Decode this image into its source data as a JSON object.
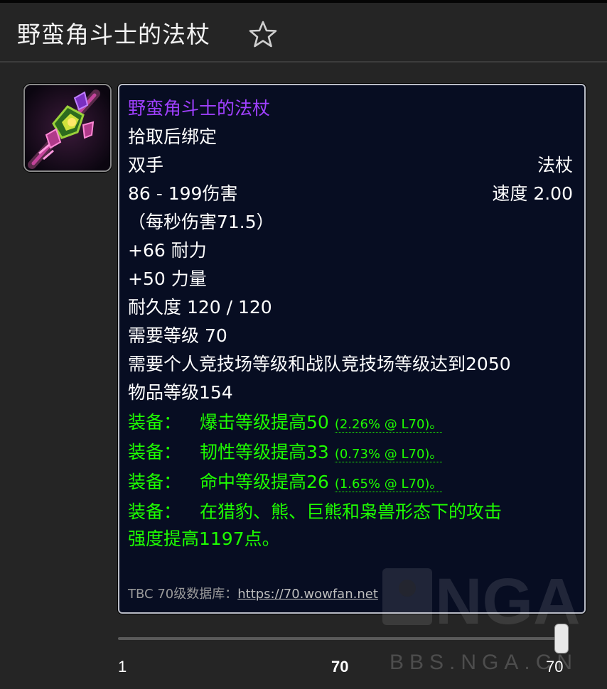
{
  "header": {
    "title": "野蛮角斗士的法杖"
  },
  "item": {
    "name": "野蛮角斗士的法杖",
    "binding": "拾取后绑定",
    "slot": "双手",
    "type": "法杖",
    "damage": "86 - 199伤害",
    "speed": "速度 2.00",
    "dps": "（每秒伤害71.5）",
    "stat1": "+66 耐力",
    "stat2": "+50 力量",
    "durability": "耐久度 120 / 120",
    "required_level": "需要等级 70",
    "arena_requirement": "需要个人竞技场等级和战队竞技场等级达到2050",
    "item_level": "物品等级154",
    "equip_label": "装备：",
    "equip1": "爆击等级提高50",
    "equip1_note": "(2.26% @ L70)。",
    "equip2": "韧性等级提高33",
    "equip2_note": "(0.73% @ L70)。",
    "equip3": "命中等级提高26",
    "equip3_note": "(1.65% @ L70)。",
    "equip4_line1": "在猎豹、熊、巨熊和枭兽形态下的攻击",
    "equip4_line2": "强度提高1197点。",
    "footer_prefix": "TBC 70级数据库：",
    "footer_link": "https://70.wowfan.net"
  },
  "level_slider": {
    "min_label": "1",
    "current_label": "70",
    "max_label": "70",
    "value": 70,
    "min": 1,
    "max": 70
  },
  "watermark": {
    "logo": "NGA",
    "site": "BBS.NGA.CN"
  },
  "colors": {
    "epic": "#a040ff",
    "equip": "#1eff00",
    "tooltip_bg": "#070d22"
  },
  "icons": {
    "favorite": "star-outline-icon",
    "item": "staff-item-icon"
  }
}
